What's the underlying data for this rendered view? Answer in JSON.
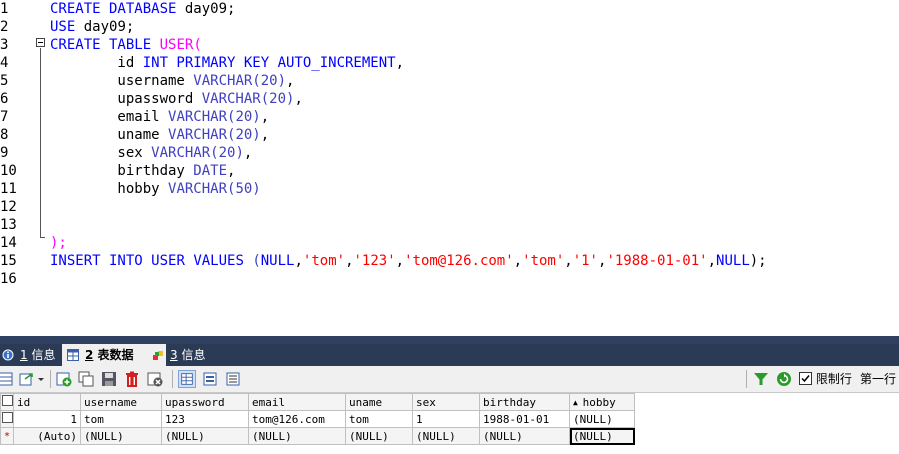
{
  "editor": {
    "line_numbers": [
      "1",
      "2",
      "3",
      "4",
      "5",
      "6",
      "7",
      "8",
      "9",
      "10",
      "11",
      "12",
      "13",
      "14",
      "15",
      "16"
    ],
    "lines": [
      [
        {
          "t": "CREATE DATABASE",
          "c": "kw"
        },
        {
          "t": " day09;",
          "c": ""
        }
      ],
      [
        {
          "t": "USE",
          "c": "kw"
        },
        {
          "t": " day09;",
          "c": ""
        }
      ],
      [
        {
          "t": "CREATE TABLE",
          "c": "kw"
        },
        {
          "t": " ",
          "c": ""
        },
        {
          "t": "USER",
          "c": "tbl"
        },
        {
          "t": "(",
          "c": "tbl"
        }
      ],
      [
        {
          "t": "        id ",
          "c": ""
        },
        {
          "t": "INT PRIMARY KEY AUTO_INCREMENT",
          "c": "kw"
        },
        {
          "t": ",",
          "c": ""
        }
      ],
      [
        {
          "t": "        username ",
          "c": ""
        },
        {
          "t": "VARCHAR(20)",
          "c": "typ"
        },
        {
          "t": ",",
          "c": ""
        }
      ],
      [
        {
          "t": "        upassword ",
          "c": ""
        },
        {
          "t": "VARCHAR(20)",
          "c": "typ"
        },
        {
          "t": ",",
          "c": ""
        }
      ],
      [
        {
          "t": "        email ",
          "c": ""
        },
        {
          "t": "VARCHAR(20)",
          "c": "typ"
        },
        {
          "t": ",",
          "c": ""
        }
      ],
      [
        {
          "t": "        uname ",
          "c": ""
        },
        {
          "t": "VARCHAR(20)",
          "c": "typ"
        },
        {
          "t": ",",
          "c": ""
        }
      ],
      [
        {
          "t": "        sex ",
          "c": ""
        },
        {
          "t": "VARCHAR(20)",
          "c": "typ"
        },
        {
          "t": ",",
          "c": ""
        }
      ],
      [
        {
          "t": "        birthday ",
          "c": ""
        },
        {
          "t": "DATE",
          "c": "typ"
        },
        {
          "t": ",",
          "c": ""
        }
      ],
      [
        {
          "t": "        hobby ",
          "c": ""
        },
        {
          "t": "VARCHAR(50)",
          "c": "typ"
        }
      ],
      [],
      [],
      [
        {
          "t": ");",
          "c": "tbl"
        }
      ],
      [
        {
          "t": "INSERT INTO",
          "c": "kw"
        },
        {
          "t": " ",
          "c": ""
        },
        {
          "t": "USER",
          "c": "kw"
        },
        {
          "t": " ",
          "c": ""
        },
        {
          "t": "VALUES",
          "c": "kw"
        },
        {
          "t": " (",
          "c": "fn"
        },
        {
          "t": "NULL",
          "c": "kw"
        },
        {
          "t": ",",
          "c": ""
        },
        {
          "t": "'tom'",
          "c": "str"
        },
        {
          "t": ",",
          "c": ""
        },
        {
          "t": "'123'",
          "c": "str"
        },
        {
          "t": ",",
          "c": ""
        },
        {
          "t": "'tom@126.com'",
          "c": "str"
        },
        {
          "t": ",",
          "c": ""
        },
        {
          "t": "'tom'",
          "c": "str"
        },
        {
          "t": ",",
          "c": ""
        },
        {
          "t": "'1'",
          "c": "str"
        },
        {
          "t": ",",
          "c": ""
        },
        {
          "t": "'1988-01-01'",
          "c": "str"
        },
        {
          "t": ",",
          "c": ""
        },
        {
          "t": "NULL",
          "c": "kw"
        },
        {
          "t": ");",
          "c": ""
        }
      ],
      []
    ]
  },
  "tabs": [
    {
      "num": "1",
      "label": " 信息",
      "icon": "info-icon"
    },
    {
      "num": "2",
      "label": " 表数据",
      "icon": "table-icon"
    },
    {
      "num": "3",
      "label": " 信息",
      "icon": "info-colored-icon"
    }
  ],
  "toolbar": {
    "limit_label": "限制行",
    "first_row_label": "第一行",
    "limit_checked": true
  },
  "grid": {
    "columns": [
      "id",
      "username",
      "upassword",
      "email",
      "uname",
      "sex",
      "birthday",
      "hobby"
    ],
    "sorted_column": "hobby",
    "rows": [
      {
        "marker": "",
        "cells": [
          "1",
          "tom",
          "123",
          "tom@126.com",
          "tom",
          "1",
          "1988-01-01",
          "(NULL)"
        ]
      },
      {
        "marker": "*",
        "cells": [
          "(Auto)",
          "(NULL)",
          "(NULL)",
          "(NULL)",
          "(NULL)",
          "(NULL)",
          "(NULL)",
          "(NULL)"
        ]
      }
    ]
  },
  "colors": {
    "keyword": "#0000ff",
    "string": "#ff0000",
    "table_name": "#ff00ff",
    "panel_bg": "#2b3a55"
  }
}
